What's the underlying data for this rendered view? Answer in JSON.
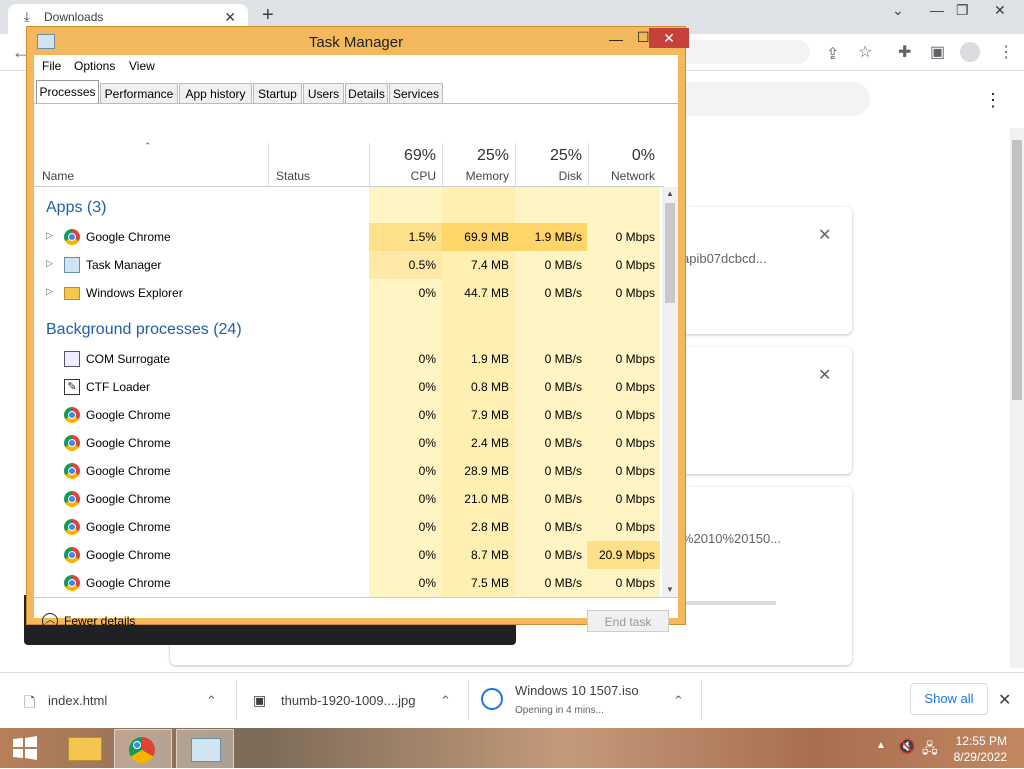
{
  "browser": {
    "tab_title": "Downloads",
    "cards": [
      {
        "filename": "apib07dcbcd..."
      },
      {
        "filename": ""
      },
      {
        "filename": "%2010%20150..."
      }
    ]
  },
  "download_bar": {
    "items": [
      {
        "name": "index.html",
        "status": ""
      },
      {
        "name": "thumb-1920-1009....jpg",
        "status": ""
      },
      {
        "name": "Windows 10 1507.iso",
        "status": "Opening in 4 mins..."
      }
    ],
    "show_all": "Show all"
  },
  "taskbar": {
    "time": "12:55 PM",
    "date": "8/29/2022"
  },
  "task_manager": {
    "title": "Task Manager",
    "menu": [
      "File",
      "Options",
      "View"
    ],
    "tabs": [
      "Processes",
      "Performance",
      "App history",
      "Startup",
      "Users",
      "Details",
      "Services"
    ],
    "selected_tab": "Processes",
    "columns": {
      "name": "Name",
      "status": "Status",
      "cpu_pct": "69%",
      "cpu": "CPU",
      "memory_pct": "25%",
      "memory": "Memory",
      "disk_pct": "25%",
      "disk": "Disk",
      "network_pct": "0%",
      "network": "Network"
    },
    "groups": {
      "apps": "Apps (3)",
      "background": "Background processes (24)"
    },
    "apps": [
      {
        "name": "Google Chrome",
        "cpu": "1.5%",
        "memory": "69.9 MB",
        "disk": "1.9 MB/s",
        "network": "0 Mbps",
        "icon": "chrome-icon"
      },
      {
        "name": "Task Manager",
        "cpu": "0.5%",
        "memory": "7.4 MB",
        "disk": "0 MB/s",
        "network": "0 Mbps",
        "icon": "task-manager-icon"
      },
      {
        "name": "Windows Explorer",
        "cpu": "0%",
        "memory": "44.7 MB",
        "disk": "0 MB/s",
        "network": "0 Mbps",
        "icon": "folder-icon"
      }
    ],
    "background": [
      {
        "name": "COM Surrogate",
        "cpu": "0%",
        "memory": "1.9 MB",
        "disk": "0 MB/s",
        "network": "0 Mbps",
        "icon": "window-icon"
      },
      {
        "name": "CTF Loader",
        "cpu": "0%",
        "memory": "0.8 MB",
        "disk": "0 MB/s",
        "network": "0 Mbps",
        "icon": "pen-icon"
      },
      {
        "name": "Google Chrome",
        "cpu": "0%",
        "memory": "7.9 MB",
        "disk": "0 MB/s",
        "network": "0 Mbps",
        "icon": "chrome-icon"
      },
      {
        "name": "Google Chrome",
        "cpu": "0%",
        "memory": "2.4 MB",
        "disk": "0 MB/s",
        "network": "0 Mbps",
        "icon": "chrome-icon"
      },
      {
        "name": "Google Chrome",
        "cpu": "0%",
        "memory": "28.9 MB",
        "disk": "0 MB/s",
        "network": "0 Mbps",
        "icon": "chrome-icon"
      },
      {
        "name": "Google Chrome",
        "cpu": "0%",
        "memory": "21.0 MB",
        "disk": "0 MB/s",
        "network": "0 Mbps",
        "icon": "chrome-icon"
      },
      {
        "name": "Google Chrome",
        "cpu": "0%",
        "memory": "2.8 MB",
        "disk": "0 MB/s",
        "network": "0 Mbps",
        "icon": "chrome-icon"
      },
      {
        "name": "Google Chrome",
        "cpu": "0%",
        "memory": "8.7 MB",
        "disk": "0 MB/s",
        "network": "20.9 Mbps",
        "icon": "chrome-icon"
      },
      {
        "name": "Google Chrome",
        "cpu": "0%",
        "memory": "7.5 MB",
        "disk": "0 MB/s",
        "network": "0 Mbps",
        "icon": "chrome-icon"
      }
    ],
    "fewer_details": "Fewer details",
    "end_task": "End task"
  }
}
